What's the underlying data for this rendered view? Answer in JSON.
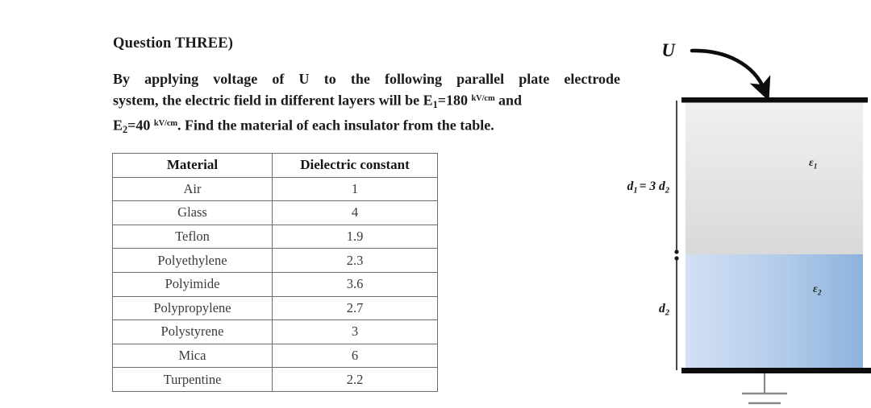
{
  "question": {
    "heading": "Question THREE)",
    "line1": "By applying voltage of U to the following parallel plate electrode",
    "line2_a": "system, the electric field in different layers will be E",
    "line2_sub": "1",
    "line2_b": "=180",
    "line2_unit": "kV/cm",
    "line2_c": "and",
    "line3_a": "E",
    "line3_sub": "2",
    "line3_b": "=40",
    "line3_unit": "kV/cm",
    "line3_c": ". Find the material of each insulator from the table."
  },
  "table": {
    "headers": [
      "Material",
      "Dielectric constant"
    ],
    "rows": [
      [
        "Air",
        "1"
      ],
      [
        "Glass",
        "4"
      ],
      [
        "Teflon",
        "1.9"
      ],
      [
        "Polyethylene",
        "2.3"
      ],
      [
        "Polyimide",
        "3.6"
      ],
      [
        "Polypropylene",
        "2.7"
      ],
      [
        "Polystyrene",
        "3"
      ],
      [
        "Mica",
        "6"
      ],
      [
        "Turpentine",
        "2.2"
      ]
    ]
  },
  "diagram": {
    "voltage_label": "U",
    "thickness_relation_base": "d",
    "thickness_relation_sub1": "1",
    "thickness_relation_mid": "= 3 d",
    "thickness_relation_sub2": "2",
    "d2_label_base": "d",
    "d2_label_sub": "2",
    "eps1_base": "ε",
    "eps1_sub": "1",
    "eps2_base": "ε",
    "eps2_sub": "2",
    "colors": {
      "electrode": "#0d0d0d",
      "layer1_top": "#eeeeee",
      "layer1_bottom": "#dcdcdc",
      "layer2_left": "#cfddf2",
      "layer2_right": "#8fb4dd",
      "ground": "#8a8a8a"
    }
  }
}
